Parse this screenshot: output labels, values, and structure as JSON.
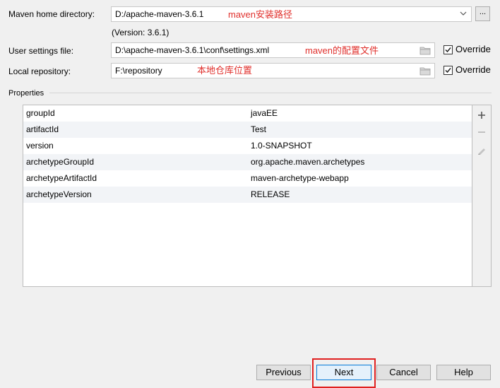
{
  "fields": {
    "maven_home": {
      "label": "Maven home directory:",
      "value": "D:/apache-maven-3.6.1",
      "annotation": "maven安装路径",
      "version": "(Version: 3.6.1)"
    },
    "user_settings": {
      "label": "User settings file:",
      "value": "D:\\apache-maven-3.6.1\\conf\\settings.xml",
      "annotation": "maven的配置文件",
      "override_label": "Override",
      "override_checked": true
    },
    "local_repo": {
      "label": "Local repository:",
      "value": "F:\\repository",
      "annotation": "本地仓库位置",
      "override_label": "Override",
      "override_checked": true
    }
  },
  "browse_label": "...",
  "properties": {
    "title": "Properties",
    "rows": [
      {
        "key": "groupId",
        "value": "javaEE"
      },
      {
        "key": "artifactId",
        "value": "Test"
      },
      {
        "key": "version",
        "value": "1.0-SNAPSHOT"
      },
      {
        "key": "archetypeGroupId",
        "value": "org.apache.maven.archetypes"
      },
      {
        "key": "archetypeArtifactId",
        "value": "maven-archetype-webapp"
      },
      {
        "key": "archetypeVersion",
        "value": "RELEASE"
      }
    ],
    "toolbar": [
      "add-icon",
      "remove-icon",
      "edit-icon"
    ]
  },
  "buttons": {
    "previous": "Previous",
    "next": "Next",
    "cancel": "Cancel",
    "help": "Help"
  },
  "colors": {
    "annotation": "#e0302c",
    "highlight": "#e02020",
    "default_button_border": "#0078d7"
  }
}
